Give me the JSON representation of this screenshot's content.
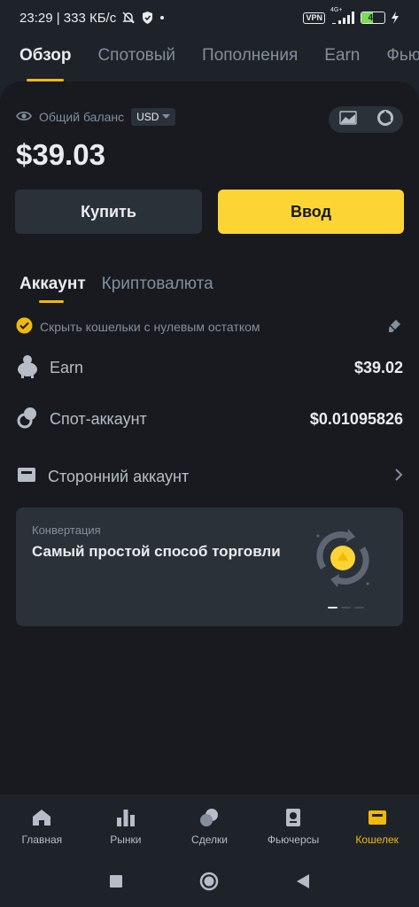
{
  "status_bar": {
    "time_speed": "23:29 | 333 КБ/с",
    "vpn": "VPN",
    "network": "4G+",
    "battery": "49",
    "battery_level": 0.49
  },
  "top_tabs": [
    {
      "label": "Обзор",
      "active": true
    },
    {
      "label": "Спотовый",
      "active": false
    },
    {
      "label": "Пополнения",
      "active": false
    },
    {
      "label": "Earn",
      "active": false
    },
    {
      "label": "Фьючерсы",
      "active": false
    }
  ],
  "balance": {
    "label": "Общий баланс",
    "currency": "USD",
    "value": "$39.03"
  },
  "actions": {
    "buy_label": "Купить",
    "deposit_label": "Ввод"
  },
  "sub_tabs": [
    {
      "label": "Аккаунт",
      "active": true
    },
    {
      "label": "Криптовалюта",
      "active": false
    }
  ],
  "hide_zero_label": "Скрыть кошельки с нулевым остатком",
  "accounts": [
    {
      "name": "Earn",
      "value": "$39.02",
      "icon": "piggy-bank-icon"
    },
    {
      "name": "Спот-аккаунт",
      "value": "$0.01095826",
      "icon": "spot-coins-icon"
    },
    {
      "name": "Сторонний аккаунт",
      "value": "",
      "icon": "wallet-card-icon"
    }
  ],
  "promo": {
    "kicker": "Конвертация",
    "headline": "Самый простой способ торговли",
    "slides": 3,
    "active_slide": 1
  },
  "bottom_nav": [
    {
      "label": "Главная",
      "icon": "home-icon",
      "active": false
    },
    {
      "label": "Рынки",
      "icon": "markets-icon",
      "active": false
    },
    {
      "label": "Сделки",
      "icon": "trades-icon",
      "active": false
    },
    {
      "label": "Фьючерсы",
      "icon": "futures-icon",
      "active": false
    },
    {
      "label": "Кошелек",
      "icon": "wallet-icon",
      "active": true
    }
  ],
  "colors": {
    "accent": "#f0b90b",
    "button_yellow": "#fcd535",
    "background": "#181a20",
    "surface": "#2b3139",
    "text_muted": "#848e9c"
  }
}
